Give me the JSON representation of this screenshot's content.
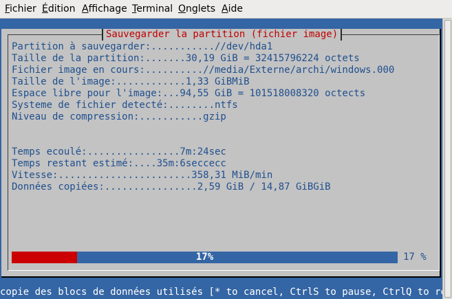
{
  "menu": {
    "items": [
      {
        "first": "F",
        "rest": "ichier"
      },
      {
        "first": "É",
        "rest": "dition"
      },
      {
        "first": "A",
        "rest": "ffichage"
      },
      {
        "first": "T",
        "rest": "erminal"
      },
      {
        "first": "O",
        "rest": "nglets"
      },
      {
        "first": "A",
        "rest": "ide"
      }
    ]
  },
  "dialog": {
    "title": "Sauvegarder la partition (fichier image)",
    "lines": [
      "Partition à sauvegarder:...........//dev/hda1",
      "Taille de la partition:.......30,19 GiB = 32415796224 octets",
      "Fichier image en cours:..........//media/Externe/archi/windows.000",
      "Taille de l'image:............1,33 GiBMiB",
      "Espace libre pour l'image:...94,55 GiB = 101518008320 octects",
      "Systeme de fichier detecté:........ntfs",
      "Niveau de compression:...........gzip",
      "Temps ecoulé:................7m:24sec",
      "Temps restant estimé:....35m:6seccecc",
      "Vitesse:.......................358,31 MiB/min",
      "Données copiées:................2,59 GiB / 14,87 GiBGiB"
    ]
  },
  "progress": {
    "value": 0.17,
    "label": "17%",
    "right_label": "17 %"
  },
  "status_line": "copie des blocs de données utilisés [* to cancel, CtrlS to pause, CtrlQ to resum",
  "colors": {
    "terminal_bg": "#3465a4",
    "dialog_bg": "#c3c3c3",
    "title_text": "#c00000",
    "info_text": "#1f4f8e",
    "progress_fill": "#cc0000"
  }
}
